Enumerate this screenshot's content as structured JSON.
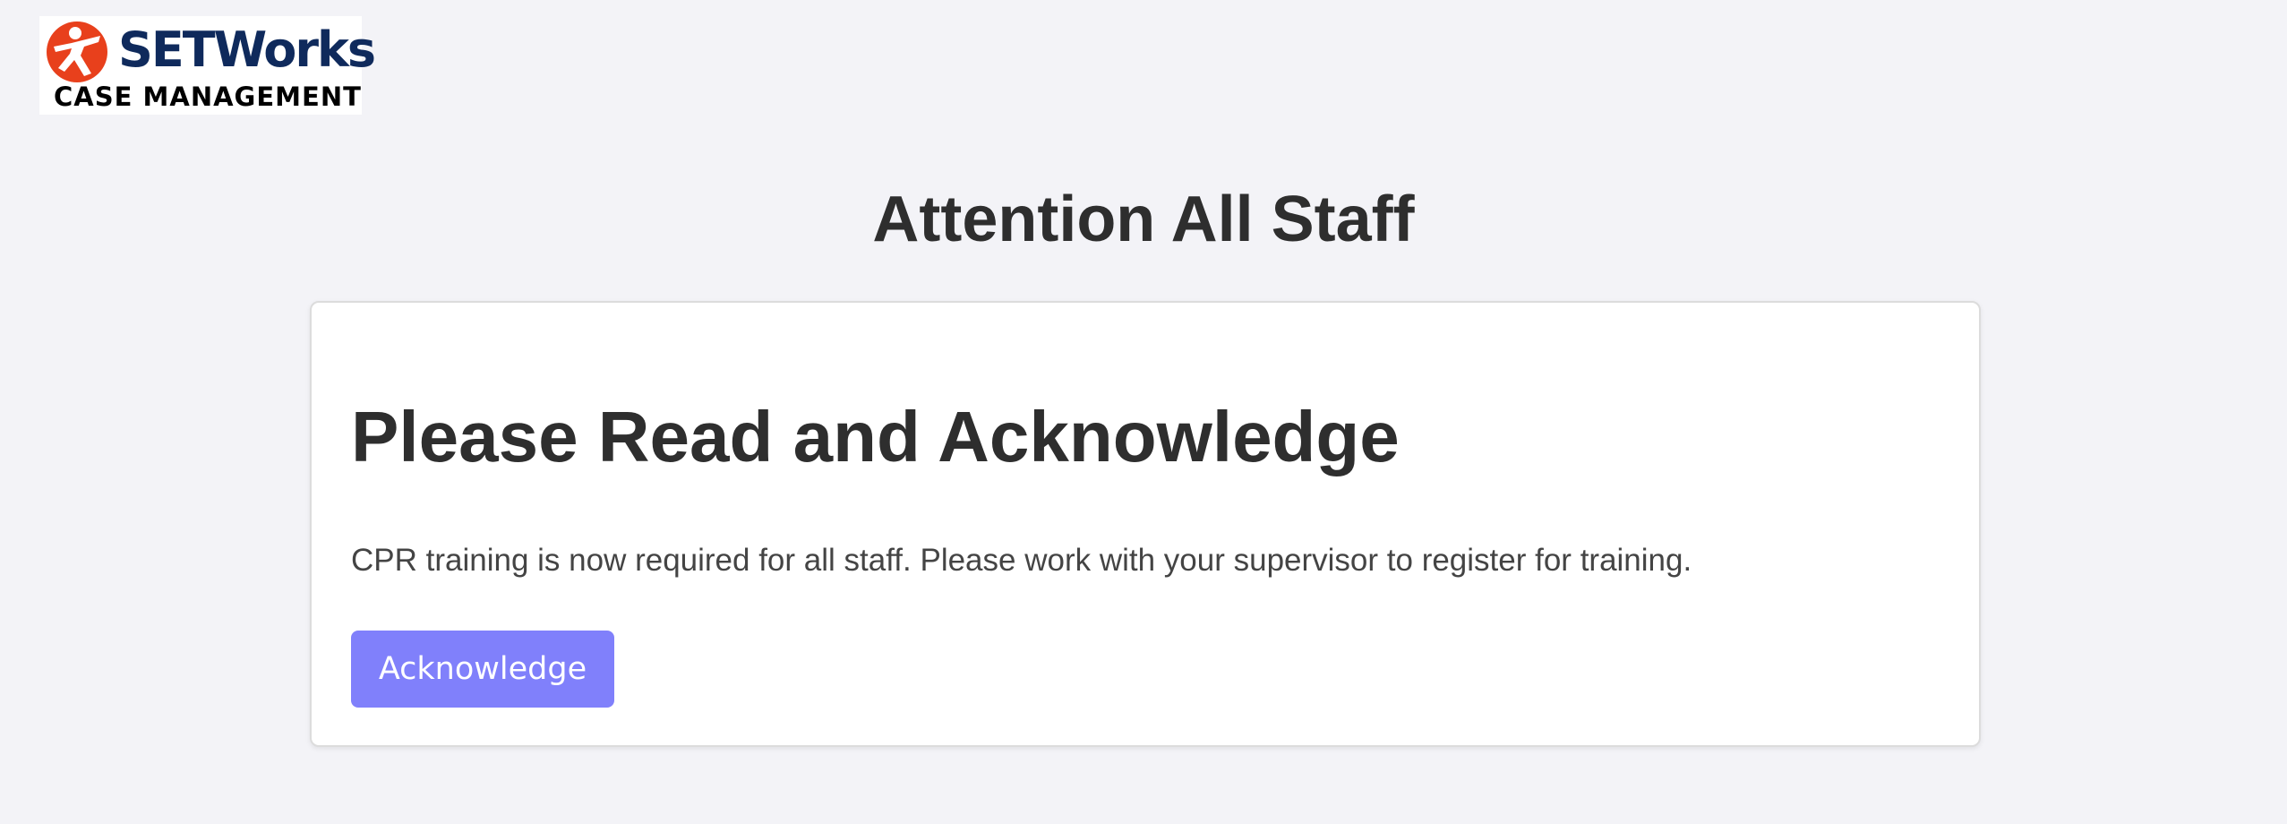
{
  "logo": {
    "brand_text": "SETWorks",
    "subtitle": "CASE MANAGEMENT",
    "icon": "running-person-icon",
    "colors": {
      "circle": "#e8401c",
      "text": "#0f2a5c"
    }
  },
  "page": {
    "title": "Attention All Staff",
    "background": "#f3f3f7"
  },
  "notice": {
    "heading": "Please Read and Acknowledge",
    "message": "CPR training is now required for all staff. Please work with your supervisor to register for training.",
    "button_label": "Acknowledge",
    "button_color": "#8080fb"
  }
}
